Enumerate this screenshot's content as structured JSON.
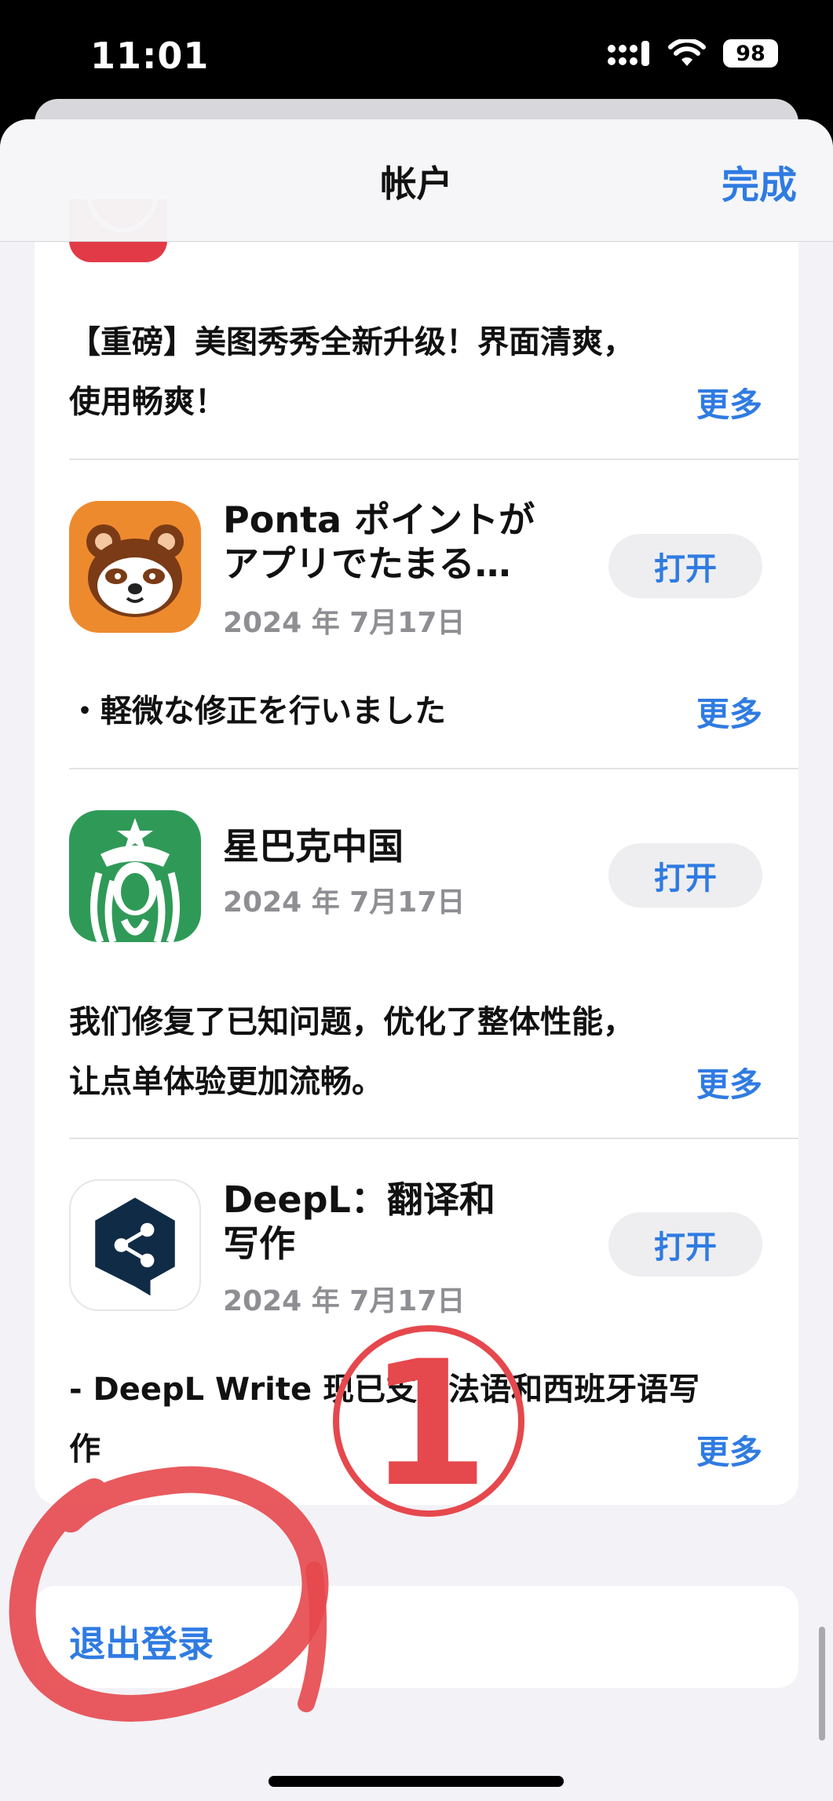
{
  "status_bar": {
    "time": "11:01",
    "battery": "98"
  },
  "nav": {
    "title": "帐户",
    "done_label": "完成"
  },
  "top_notes": {
    "line1": "【重磅】美图秀秀全新升级！界面清爽，",
    "line2": "使用畅爽！",
    "more": "更多"
  },
  "apps": [
    {
      "name_line1": "Ponta ポイントが",
      "name_line2": "アプリでたまる…",
      "date": "2024 年 7月17日",
      "open": "打开",
      "notes_line1": "・軽微な修正を行いました",
      "notes_line2": "",
      "more": "更多",
      "icon": "ponta-bear-icon"
    },
    {
      "name_line1": "星巴克中国",
      "name_line2": "",
      "date": "2024 年 7月17日",
      "open": "打开",
      "notes_line1": "我们修复了已知问题，优化了整体性能，",
      "notes_line2": "让点单体验更加流畅。",
      "more": "更多",
      "icon": "starbucks-siren-icon"
    },
    {
      "name_line1": "DeepL：翻译和",
      "name_line2": "写作",
      "date": "2024 年 7月17日",
      "open": "打开",
      "notes_line1": "- DeepL Write 现已支持法语和西班牙语写",
      "notes_line2": "作",
      "more": "更多",
      "icon": "deepl-share-icon"
    }
  ],
  "logout": {
    "label": "退出登录"
  },
  "annotation": {
    "number": "1"
  },
  "colors": {
    "accent": "#2f7be2",
    "annotation_red": "#e5484d"
  }
}
